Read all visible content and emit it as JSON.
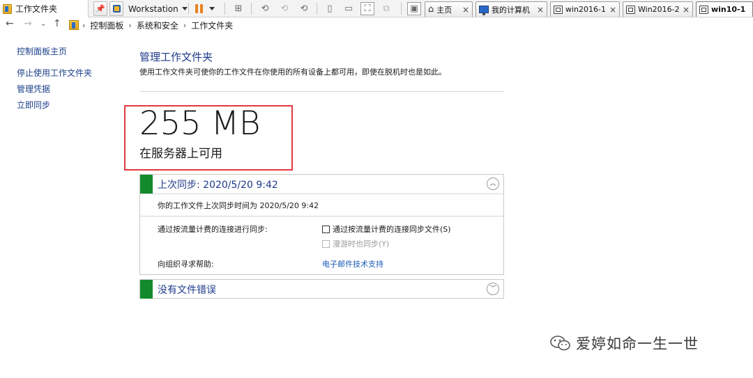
{
  "window": {
    "title": "工作文件夹"
  },
  "vmware": {
    "menu_label": "Workstation",
    "tabs": [
      {
        "label": "主页",
        "icon": "home-icon"
      },
      {
        "label": "我的计算机",
        "icon": "computer-icon"
      },
      {
        "label": "win2016-1",
        "icon": "vm-icon"
      },
      {
        "label": "Win2016-2",
        "icon": "vm-icon"
      },
      {
        "label": "win10-1",
        "icon": "vm-icon",
        "active": true
      }
    ],
    "close_glyph": "×"
  },
  "address": {
    "crumbs": [
      "控制面板",
      "系统和安全",
      "工作文件夹"
    ]
  },
  "sidebar": {
    "items": [
      {
        "label": "控制面板主页"
      },
      {
        "label": "停止使用工作文件夹"
      },
      {
        "label": "管理凭据"
      },
      {
        "label": "立即同步"
      }
    ]
  },
  "main": {
    "title": "管理工作文件夹",
    "description": "使用工作文件夹可使你的工作文件在你使用的所有设备上都可用，即使在脱机时也是如此。",
    "storage": {
      "value": "255 MB",
      "caption": "在服务器上可用"
    },
    "sync_panel": {
      "title": "上次同步: 2020/5/20 9:42",
      "last_sync_text": "你的工作文件上次同步时间为 2020/5/20 9:42",
      "metered_label": "通过按流量计费的连接进行同步:",
      "metered_checkbox": "通过按流量计费的连接同步文件(S)",
      "metered_checked": false,
      "roaming_checkbox": "漫游时也同步(Y)",
      "roaming_enabled": false,
      "help_label": "向组织寻求帮助:",
      "help_link": "电子邮件技术支持"
    },
    "errors_panel": {
      "title": "没有文件错误"
    }
  },
  "watermark": {
    "text": "爱婷如命一生一世"
  },
  "colors": {
    "accent_green": "#138a2c",
    "heading_blue": "#1e3a8a",
    "highlight_red": "#e0393e",
    "link_blue": "#1a5bb5"
  }
}
